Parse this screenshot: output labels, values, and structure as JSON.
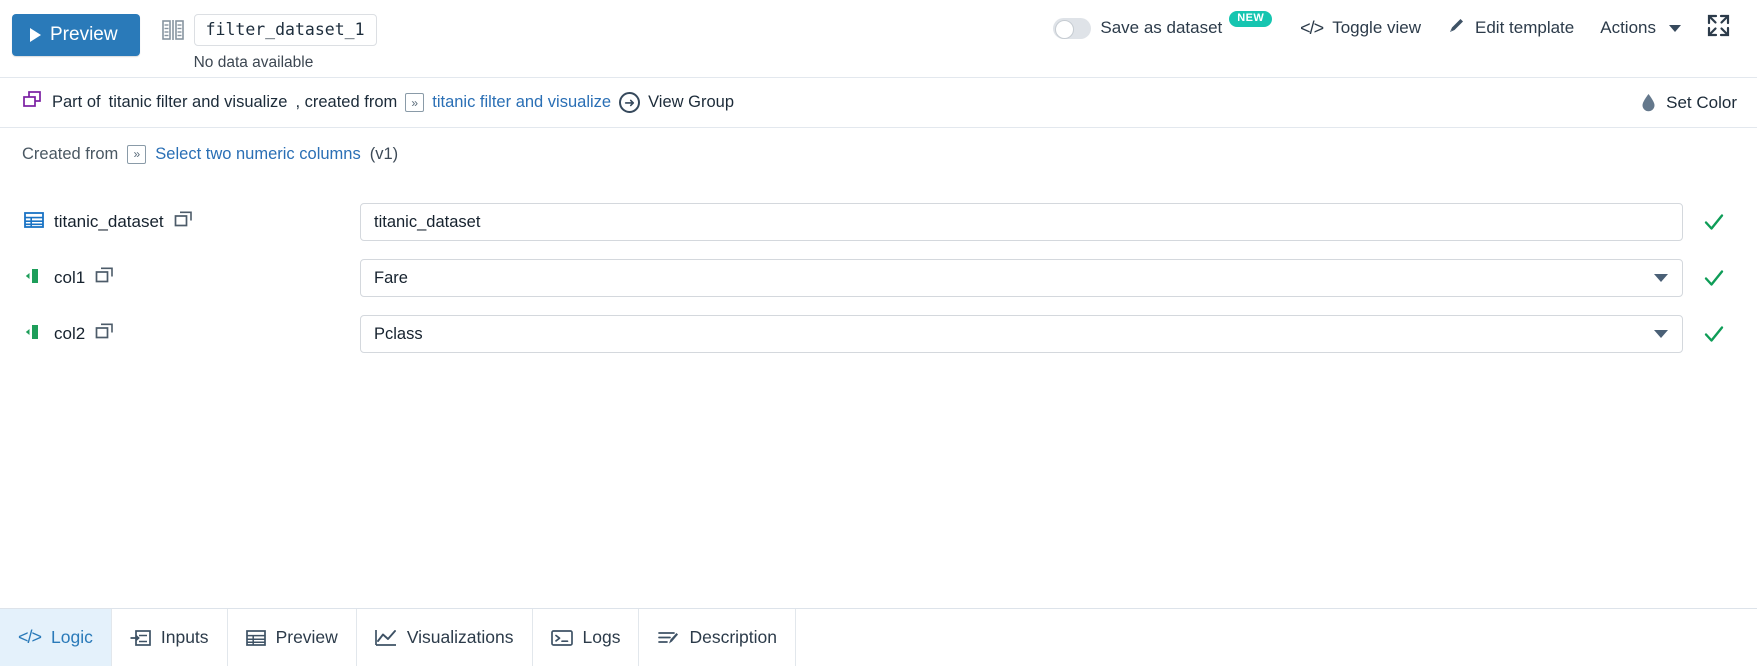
{
  "toolbar": {
    "preview_button": "Preview",
    "recipe_name_value": "filter_dataset_1",
    "status_text": "No data available",
    "save_as_dataset_label": "Save as dataset",
    "new_badge": "NEW",
    "toggle_view_label": "Toggle view",
    "edit_template_label": "Edit template",
    "actions_label": "Actions",
    "accent_color": "#2a7ab9",
    "badge_color": "#16c5b0"
  },
  "partof": {
    "prefix": "Part of",
    "group_name": "titanic filter and visualize",
    "created_from_text": ", created from",
    "source_link": "titanic filter and visualize",
    "view_group_label": "View Group",
    "set_color_label": "Set Color"
  },
  "created_from": {
    "label": "Created from",
    "recipe_link": "Select two numeric columns",
    "version": "(v1)"
  },
  "form": {
    "rows": [
      {
        "label": "titanic_dataset",
        "icon": "table-icon",
        "value": "titanic_dataset",
        "type": "text",
        "valid": true
      },
      {
        "label": "col1",
        "icon": "column-icon",
        "value": "Fare",
        "type": "select",
        "valid": true
      },
      {
        "label": "col2",
        "icon": "column-icon",
        "value": "Pclass",
        "type": "select",
        "valid": true
      }
    ]
  },
  "tabs": [
    {
      "label": "Logic",
      "icon": "code-icon",
      "active": true
    },
    {
      "label": "Inputs",
      "icon": "inputs-icon",
      "active": false
    },
    {
      "label": "Preview",
      "icon": "table-icon",
      "active": false
    },
    {
      "label": "Visualizations",
      "icon": "chart-line-icon",
      "active": false
    },
    {
      "label": "Logs",
      "icon": "terminal-icon",
      "active": false
    },
    {
      "label": "Description",
      "icon": "description-icon",
      "active": false
    }
  ]
}
